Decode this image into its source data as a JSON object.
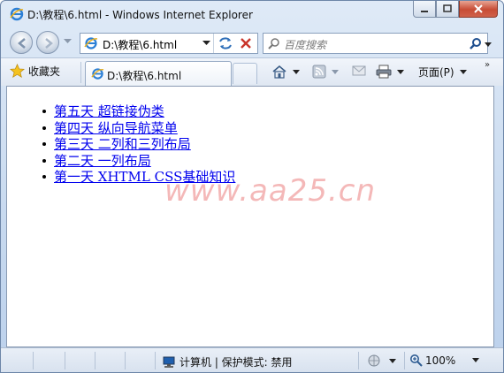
{
  "window": {
    "title": "D:\\教程\\6.html - Windows Internet Explorer"
  },
  "address": {
    "url": "D:\\教程\\6.html"
  },
  "search": {
    "placeholder": "百度搜索"
  },
  "favorites": {
    "label": "收藏夹"
  },
  "tab": {
    "title": "D:\\教程\\6.html"
  },
  "commandbar": {
    "page_label": "页面(P)"
  },
  "content": {
    "links": [
      "第五天 超链接伪类",
      "第四天 纵向导航菜单",
      "第三天 二列和三列布局",
      "第二天 一列布局",
      "第一天 XHTML CSS基础知识"
    ],
    "watermark": "www.aa25.cn"
  },
  "status": {
    "zone": "计算机 | 保护模式: 禁用",
    "zoom": "100%"
  }
}
